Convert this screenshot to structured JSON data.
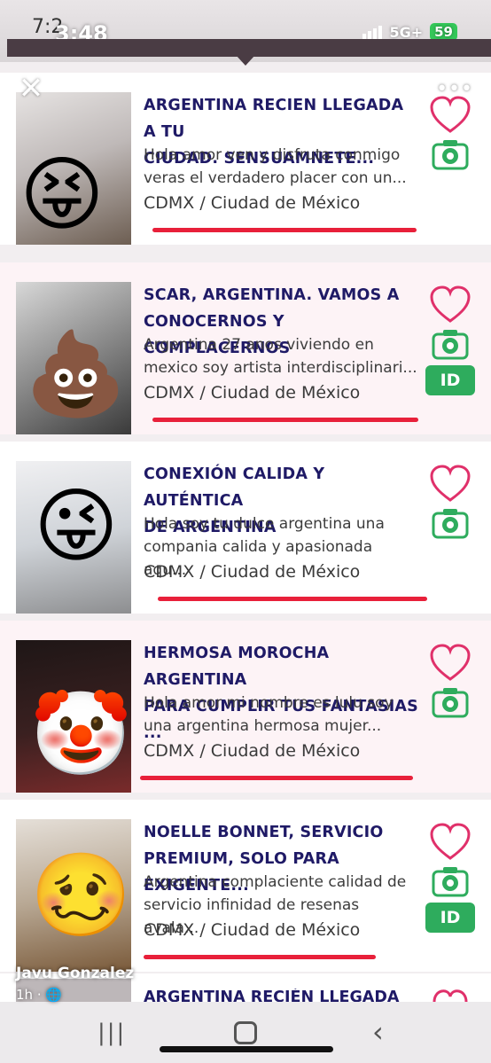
{
  "status": {
    "inner_time": "7:2",
    "outer_time": "3:48",
    "network": "5G+",
    "battery": "59"
  },
  "colors": {
    "title": "#1f1a66",
    "accent_red": "#e8203a",
    "green": "#2eac5d"
  },
  "listings": [
    {
      "title_line1": "ARGENTINA RECIEN LLEGADA A TU",
      "title_line2": "CIUDAD. SENSUAMNETE...",
      "desc_line1": "Hola amor ven y disfruta conmigo",
      "desc_line2": "veras el verdadero placer con un...",
      "location": "CDMX / Ciudad de México",
      "emoji": "😝",
      "has_id": false
    },
    {
      "title_line1": "SCAR, ARGENTINA. VAMOS A",
      "title_line2": "CONOCERNOS Y COMPLACERNOS",
      "desc_line1": "Argentina 27 anos viviendo en",
      "desc_line2": "mexico soy artista interdisciplinari...",
      "location": "CDMX / Ciudad de México",
      "emoji": "💩",
      "has_id": true,
      "id_label": "ID"
    },
    {
      "title_line1": "CONEXIÓN CALIDA Y AUTÉNTICA",
      "title_line2": "DE ARGENTINA",
      "desc_line1": "Hola soy tu dulce argentina una",
      "desc_line2": "compania calida y apasionada aqu...",
      "location": "CDMX / Ciudad de México",
      "emoji": "😜",
      "has_id": false
    },
    {
      "title_line1": "HERMOSA MOROCHA ARGENTINA",
      "title_line2": "PARA CUMPLIR TUS FANTASIAS ...",
      "desc_line1": "Hola amor mi nombre es lulu soy",
      "desc_line2": "una argentina hermosa mujer...",
      "location": "CDMX / Ciudad de México",
      "emoji": "🤡",
      "has_id": false
    },
    {
      "title_line1": "NOELLE BONNET, SERVICIO",
      "title_line2": "PREMIUM, SOLO PARA EXIGENTE...",
      "desc_line1": "Argentina complaciente calidad de",
      "desc_line2": "servicio infinidad de resenas avala...",
      "location": "CDMX / Ciudad de México",
      "emoji": "🥴",
      "has_id": true,
      "id_label": "ID"
    }
  ],
  "next_title_partial": "ARGENTINA RECIÉN LLEGADA",
  "story": {
    "author": "Javu Gonzalez",
    "time_ago": "1h"
  }
}
